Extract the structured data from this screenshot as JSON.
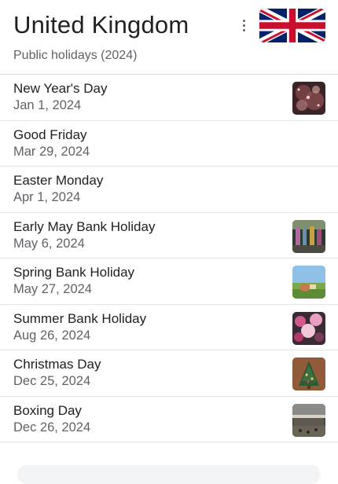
{
  "header": {
    "title": "United Kingdom",
    "subtitle": "Public holidays (2024)",
    "flag_icon": "uk-flag-icon",
    "menu_icon": "more-vert-icon"
  },
  "holidays": [
    {
      "name": "New Year's Day",
      "date": "Jan 1, 2024",
      "thumb": "fireworks-thumbnail"
    },
    {
      "name": "Good Friday",
      "date": "Mar 29, 2024"
    },
    {
      "name": "Easter Monday",
      "date": "Apr 1, 2024"
    },
    {
      "name": "Early May Bank Holiday",
      "date": "May 6, 2024",
      "thumb": "parade-thumbnail"
    },
    {
      "name": "Spring Bank Holiday",
      "date": "May 27, 2024",
      "thumb": "picnic-thumbnail"
    },
    {
      "name": "Summer Bank Holiday",
      "date": "Aug 26, 2024",
      "thumb": "carnival-thumbnail"
    },
    {
      "name": "Christmas Day",
      "date": "Dec 25, 2024",
      "thumb": "christmas-tree-thumbnail"
    },
    {
      "name": "Boxing Day",
      "date": "Dec 26, 2024",
      "thumb": "shopping-mall-thumbnail"
    }
  ],
  "colors": {
    "text_primary": "#202124",
    "text_secondary": "#5f6368",
    "divider": "#e3e3e3",
    "flag_blue": "#012169",
    "flag_red": "#C8102E"
  }
}
